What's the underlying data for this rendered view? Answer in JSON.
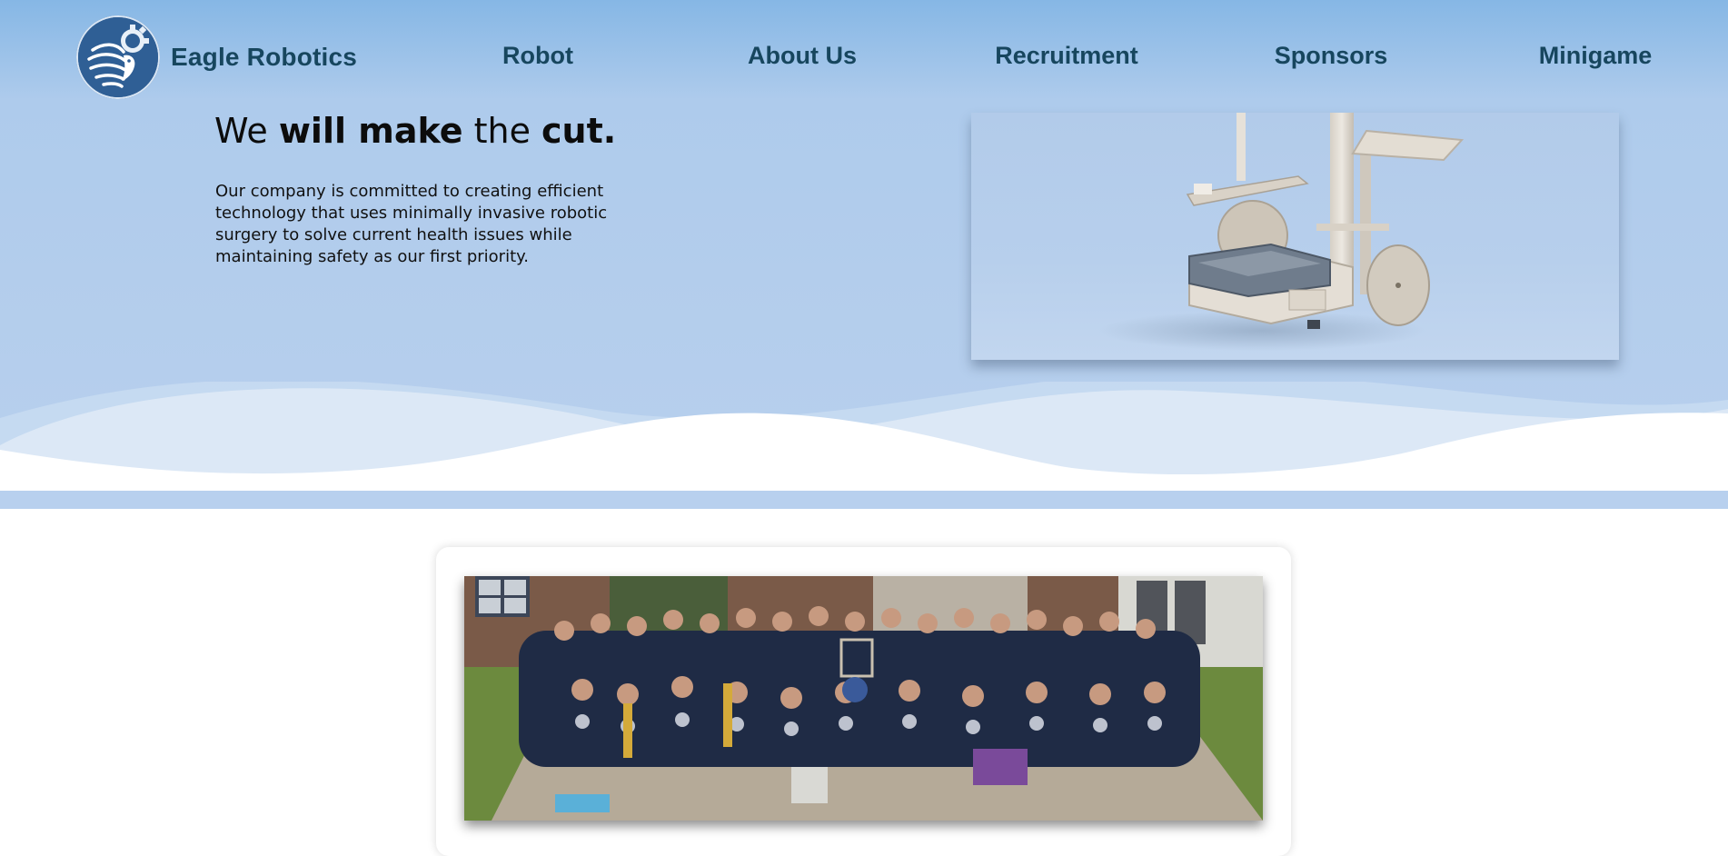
{
  "nav": {
    "brand": "Eagle Robotics",
    "logo_icon": "eagle-gear-logo-icon",
    "links": [
      "Robot",
      "About Us",
      "Recruitment",
      "Sponsors",
      "Minigame"
    ]
  },
  "hero": {
    "headline": {
      "part1": "We ",
      "part2": "will make",
      "part3": " the ",
      "part4": "cut."
    },
    "description": "Our company is committed to creating efficient technology that uses minimally invasive robotic surgery to solve current health issues while maintaining safety as our first priority.",
    "image_icon": "robot-render-image"
  },
  "team": {
    "image_icon": "team-group-photo"
  },
  "colors": {
    "nav_text": "#17465e",
    "hero_bg": "#b3cdec",
    "hero_top": "#86b7e5",
    "wave_light": "#d6e5f5"
  }
}
